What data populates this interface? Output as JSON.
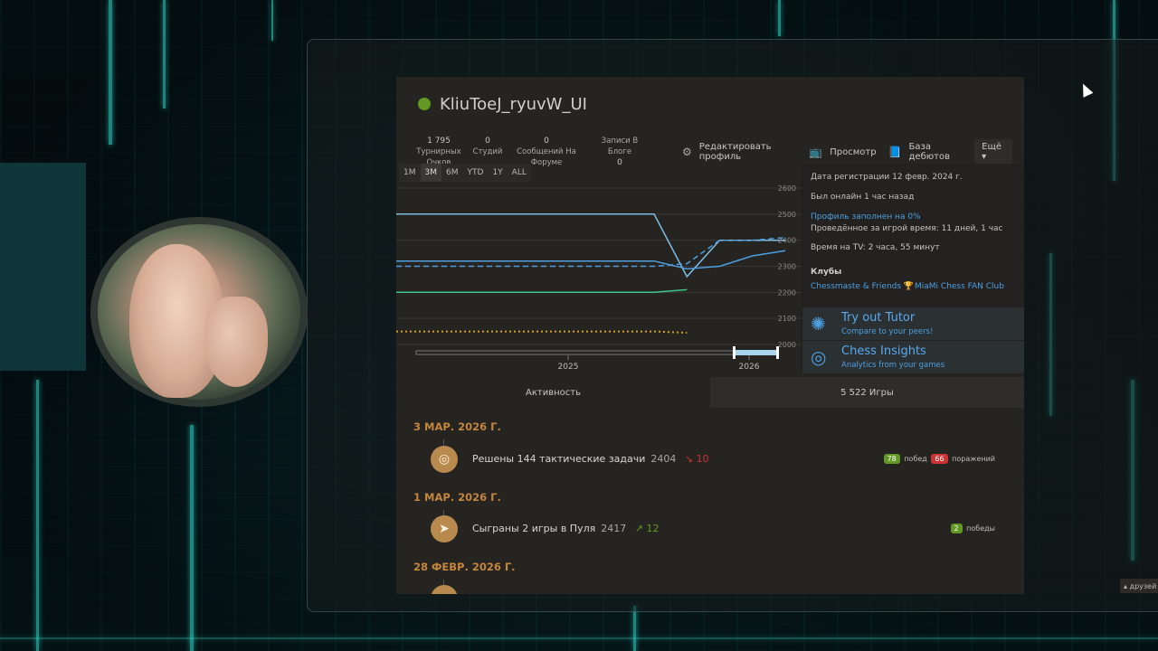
{
  "profile": {
    "username": "KliuToeJ_ryuvW_UI",
    "status_color": "#629924",
    "stats": [
      {
        "value": "1 795",
        "label": "Турнирных Очков"
      },
      {
        "value": "0",
        "label": "Студий"
      },
      {
        "value": "0",
        "label": "Сообщений На Форуме"
      },
      {
        "value": "0",
        "label": "Записи В Блоге"
      }
    ],
    "actions": [
      {
        "icon": "gear-icon",
        "label": "Редактировать профиль"
      },
      {
        "icon": "tv-icon",
        "label": "Просмотр"
      },
      {
        "icon": "book-icon",
        "label": "База дебютов"
      }
    ],
    "more_label": "Ещё ▾"
  },
  "chart": {
    "ranges": [
      "1M",
      "3M",
      "6M",
      "YTD",
      "1Y",
      "ALL"
    ],
    "active_range": "3M",
    "y_ticks": [
      "2600",
      "2500",
      "2400",
      "2300",
      "2200",
      "2100",
      "2000"
    ],
    "x_ticks": [
      "2025",
      "2026"
    ]
  },
  "chart_data": {
    "type": "line",
    "x": [
      "2024-04",
      "2024-07",
      "2024-10",
      "2025-01",
      "2025-04",
      "2025-07",
      "2025-10",
      "2025-11",
      "2025-12",
      "2026-01",
      "2026-02",
      "2026-03"
    ],
    "ylim": [
      2000,
      2600
    ],
    "series": [
      {
        "color": "#7fbfe6",
        "values": [
          2500,
          2500,
          2500,
          2500,
          2500,
          2500,
          2500,
          2500,
          2260,
          2400,
          2400,
          2400
        ]
      },
      {
        "color": "#4d9fe0",
        "values": [
          2320,
          2320,
          2320,
          2320,
          2320,
          2320,
          2320,
          2320,
          2290,
          2300,
          2340,
          2360
        ]
      },
      {
        "color": "#4d9fe0",
        "dashed": true,
        "values": [
          2300,
          2300,
          2300,
          2300,
          2300,
          2300,
          2300,
          2300,
          2310,
          2400,
          2400,
          2410
        ]
      },
      {
        "color": "#3ec78a",
        "values": [
          2200,
          2200,
          2200,
          2200,
          2200,
          2200,
          2200,
          2200,
          2210,
          null,
          null,
          null
        ]
      },
      {
        "color": "#d4a220",
        "dotted": true,
        "values": [
          2050,
          2050,
          2050,
          2050,
          2050,
          2050,
          2050,
          2050,
          2045,
          null,
          null,
          null
        ]
      }
    ]
  },
  "info": {
    "registered": "Дата регистрации 12 февр. 2024 г.",
    "last_seen": "Был онлайн 1 час назад",
    "profile_complete": "Профиль заполнен на 0%",
    "play_time": "Проведённое за игрой время: 11 дней, 1 час",
    "tv_time": "Время на TV: 2 часа, 55 минут",
    "clubs_title": "Клубы",
    "club_1": "Chessmaste & Friends 🏆",
    "club_2": "MiaMi Chess FAN Club"
  },
  "promos": [
    {
      "icon": "octopus-icon",
      "title": "Try out Tutor",
      "subtitle": "Compare to your peers!"
    },
    {
      "icon": "target-icon",
      "title": "Chess Insights",
      "subtitle": "Analytics from your games"
    }
  ],
  "tabs": [
    {
      "label": "Активность",
      "active": true
    },
    {
      "label": "5 522 Игры",
      "active": false
    }
  ],
  "feed": {
    "groups": [
      {
        "date": "3 МАР. 2026 Г.",
        "text": "Решены 144 тактические задачи",
        "rating": "2404",
        "delta": "10",
        "direction": "down",
        "wins": "78",
        "wins_label": "побед",
        "losses": "66",
        "losses_label": "поражений"
      },
      {
        "date": "1 МАР. 2026 Г.",
        "text": "Сыграны 2 игры в Пуля",
        "rating": "2417",
        "delta": "12",
        "direction": "up",
        "wins": "2",
        "wins_label": "победы"
      },
      {
        "date": "28 ФЕВР. 2026 Г."
      }
    ]
  },
  "friends_label": "▴ друзей"
}
